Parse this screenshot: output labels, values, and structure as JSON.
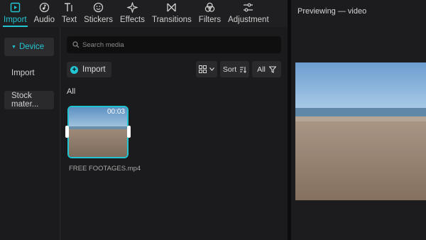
{
  "toolbar": {
    "tabs": [
      {
        "label": "Import",
        "icon": "import-icon"
      },
      {
        "label": "Audio",
        "icon": "audio-icon"
      },
      {
        "label": "Text",
        "icon": "text-icon"
      },
      {
        "label": "Stickers",
        "icon": "stickers-icon"
      },
      {
        "label": "Effects",
        "icon": "effects-icon"
      },
      {
        "label": "Transitions",
        "icon": "transitions-icon"
      },
      {
        "label": "Filters",
        "icon": "filters-icon"
      },
      {
        "label": "Adjustment",
        "icon": "adjustment-icon"
      }
    ],
    "active_tab": "Import"
  },
  "sidebar": {
    "items": [
      {
        "label": "Device"
      },
      {
        "label": "Import"
      },
      {
        "label": "Stock mater..."
      }
    ]
  },
  "media": {
    "search_placeholder": "Search media",
    "import_label": "Import",
    "sort_label": "Sort",
    "all_filter_label": "All",
    "section_label": "All",
    "clip": {
      "duration": "00:03",
      "filename": "FREE FOOTAGES.mp4"
    }
  },
  "preview": {
    "title": "Previewing — video"
  },
  "colors": {
    "accent": "#22c6d2",
    "background": "#1b1b1d"
  }
}
